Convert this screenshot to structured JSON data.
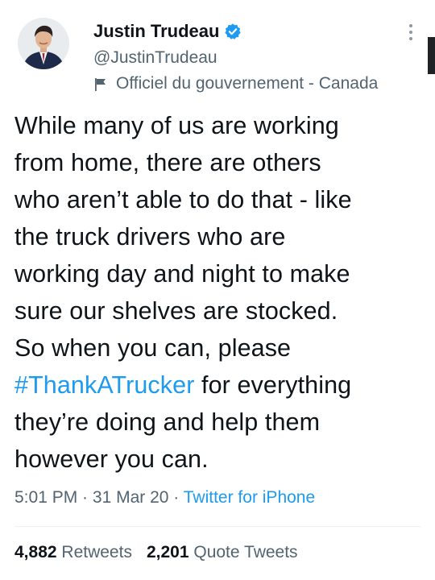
{
  "author": {
    "display_name": "Justin Trudeau",
    "handle": "@JustinTrudeau",
    "label": "Officiel du gouvernement - Canada",
    "verified_badge_color": "#1d9bf0"
  },
  "tweet": {
    "lines_before": [
      "While many of us are working",
      "from home, there are others",
      "who aren’t able to do that - like",
      "the truck drivers who are",
      "working day and night to make",
      "sure our shelves are stocked.",
      "So when you can, please"
    ],
    "hashtag": "#ThankATrucker",
    "hashtag_tail": " for everything",
    "lines_after": [
      "they’re doing and help them",
      "however you can."
    ]
  },
  "meta": {
    "time": "5:01 PM",
    "separator": " · ",
    "date": "31 Mar 20",
    "source": "Twitter for iPhone"
  },
  "stats": {
    "retweets_count": "4,882",
    "retweets_label": "Retweets",
    "quotes_count": "2,201",
    "quotes_label": "Quote Tweets"
  },
  "colors": {
    "link": "#1d9bf0",
    "secondary_text": "#536471",
    "primary_text": "#0f1419"
  }
}
